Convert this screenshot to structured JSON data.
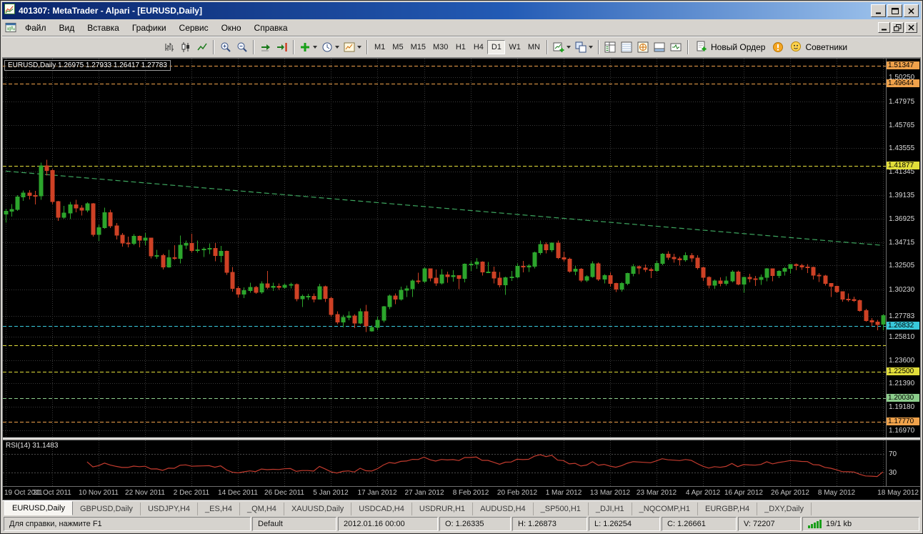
{
  "window": {
    "title": "401307: MetaTrader - Alpari - [EURUSD,Daily]"
  },
  "menu": {
    "items": [
      "Файл",
      "Вид",
      "Вставка",
      "Графики",
      "Сервис",
      "Окно",
      "Справка"
    ]
  },
  "toolbar": {
    "groups": [
      [
        "bar-chart-icon",
        "candlestick-icon",
        "line-chart-icon"
      ],
      [
        "zoom-in-icon",
        "zoom-out-icon"
      ],
      [
        "auto-scroll-icon",
        "chart-shift-icon"
      ],
      [
        {
          "icon": "indicators-icon",
          "dropdown": true
        },
        {
          "icon": "periods-icon",
          "dropdown": true
        },
        {
          "icon": "templates-icon",
          "dropdown": true
        }
      ],
      "TIMEFRAMES",
      [
        {
          "icon": "new-chart-icon",
          "dropdown": true
        },
        {
          "icon": "profiles-icon",
          "dropdown": true
        }
      ],
      [
        "market-watch-icon",
        "data-window-icon",
        "navigator-icon",
        "terminal-icon",
        "strategy-tester-icon"
      ],
      "ACTIONS"
    ],
    "timeframes": {
      "labels": [
        "M1",
        "M5",
        "M15",
        "M30",
        "H1",
        "H4",
        "D1",
        "W1",
        "MN"
      ],
      "active": "D1"
    },
    "new_order": {
      "label": "Новый Ордер",
      "icon": "new-order-icon"
    },
    "warning_icon": "warning-icon",
    "advisors": {
      "label": "Советники",
      "icon": "advisors-icon"
    }
  },
  "chart_data": {
    "type": "candlestick",
    "symbol": "EURUSD",
    "timeframe": "Daily",
    "title_ohlc": {
      "open": "1.26975",
      "high": "1.27933",
      "low": "1.26417",
      "close": "1.27783"
    },
    "y_range": [
      1.163,
      1.52
    ],
    "y_ticks": [
      "1.50250",
      "1.47975",
      "1.45765",
      "1.43555",
      "1.41345",
      "1.39135",
      "1.36925",
      "1.34715",
      "1.32505",
      "1.30230",
      "1.27783",
      "1.25810",
      "1.23600",
      "1.21390",
      "1.19180",
      "1.16970"
    ],
    "level_lines": [
      {
        "value": 1.51347,
        "label": "1.51347",
        "color": "#F0A24B"
      },
      {
        "value": 1.49644,
        "label": "1.49644",
        "color": "#F0A24B"
      },
      {
        "value": 1.41877,
        "label": "1.41877",
        "color": "#E2DE3A"
      },
      {
        "value": 1.26832,
        "label": "1.26832",
        "color": "#38C9DB"
      },
      {
        "value": 1.25,
        "label": "",
        "color": "#E2DE3A"
      },
      {
        "value": 1.225,
        "label": "1.22500",
        "color": "#E2DE3A"
      },
      {
        "value": 1.2003,
        "label": "1.20030",
        "color": "#8CCE8C"
      },
      {
        "value": 1.1777,
        "label": "1.17770",
        "color": "#F0A24B"
      }
    ],
    "trendline": {
      "from_index": 0,
      "from_value": 1.414,
      "to_index": 151,
      "to_value": 1.344,
      "color": "#3DA65F"
    },
    "colors": {
      "up": "#2CA52C",
      "down": "#CE4125",
      "background": "#000000",
      "grid": "#3A3A3A",
      "text": "#D8D8D8"
    },
    "candles": [
      [
        1.3735,
        1.3786,
        1.3655,
        1.3761
      ],
      [
        1.3761,
        1.383,
        1.371,
        1.3779
      ],
      [
        1.3779,
        1.3912,
        1.3765,
        1.3898
      ],
      [
        1.3898,
        1.3958,
        1.386,
        1.3935
      ],
      [
        1.3935,
        1.396,
        1.3873,
        1.391
      ],
      [
        1.391,
        1.3954,
        1.3826,
        1.3905
      ],
      [
        1.3905,
        1.422,
        1.387,
        1.4188
      ],
      [
        1.4188,
        1.4247,
        1.41,
        1.4147
      ],
      [
        1.4147,
        1.416,
        1.383,
        1.3852
      ],
      [
        1.3852,
        1.386,
        1.3671,
        1.3704
      ],
      [
        1.3704,
        1.3812,
        1.369,
        1.3745
      ],
      [
        1.3745,
        1.385,
        1.3687,
        1.3823
      ],
      [
        1.3823,
        1.3869,
        1.3753,
        1.3791
      ],
      [
        1.3791,
        1.3819,
        1.3723,
        1.3773
      ],
      [
        1.3773,
        1.3847,
        1.3751,
        1.3834
      ],
      [
        1.3834,
        1.3841,
        1.3523,
        1.3542
      ],
      [
        1.3542,
        1.3633,
        1.3483,
        1.3607
      ],
      [
        1.3607,
        1.3795,
        1.3597,
        1.375
      ],
      [
        1.375,
        1.3776,
        1.3603,
        1.3623
      ],
      [
        1.3623,
        1.365,
        1.3497,
        1.3535
      ],
      [
        1.3535,
        1.3556,
        1.3429,
        1.3462
      ],
      [
        1.3462,
        1.3524,
        1.3421,
        1.346
      ],
      [
        1.346,
        1.3545,
        1.3443,
        1.3525
      ],
      [
        1.3525,
        1.3532,
        1.3422,
        1.349
      ],
      [
        1.349,
        1.3555,
        1.3443,
        1.3508
      ],
      [
        1.3508,
        1.351,
        1.3317,
        1.334
      ],
      [
        1.334,
        1.3398,
        1.3315,
        1.3343
      ],
      [
        1.3343,
        1.3362,
        1.3212,
        1.3238
      ],
      [
        1.3238,
        1.3398,
        1.323,
        1.3325
      ],
      [
        1.3325,
        1.3443,
        1.3305,
        1.3318
      ],
      [
        1.3318,
        1.3533,
        1.327,
        1.3442
      ],
      [
        1.3442,
        1.3487,
        1.3406,
        1.346
      ],
      [
        1.346,
        1.355,
        1.337,
        1.339
      ],
      [
        1.339,
        1.3487,
        1.337,
        1.3398
      ],
      [
        1.3398,
        1.3421,
        1.3332,
        1.3404
      ],
      [
        1.3404,
        1.3458,
        1.3357,
        1.341
      ],
      [
        1.341,
        1.3462,
        1.329,
        1.3343
      ],
      [
        1.3343,
        1.3434,
        1.328,
        1.3386
      ],
      [
        1.3386,
        1.339,
        1.3163,
        1.3186
      ],
      [
        1.3186,
        1.3235,
        1.3005,
        1.3035
      ],
      [
        1.3035,
        1.3055,
        1.2946,
        1.2982
      ],
      [
        1.2982,
        1.3045,
        1.2945,
        1.3015
      ],
      [
        1.3015,
        1.3087,
        1.2995,
        1.3044
      ],
      [
        1.3044,
        1.3057,
        1.2983,
        1.2999
      ],
      [
        1.2999,
        1.3103,
        1.2985,
        1.3078
      ],
      [
        1.3078,
        1.3198,
        1.3028,
        1.3043
      ],
      [
        1.3043,
        1.3089,
        1.301,
        1.3054
      ],
      [
        1.3054,
        1.3083,
        1.3021,
        1.3045
      ],
      [
        1.3045,
        1.308,
        1.303,
        1.3066
      ],
      [
        1.3066,
        1.3089,
        1.3033,
        1.3071
      ],
      [
        1.3071,
        1.308,
        1.2912,
        1.2938
      ],
      [
        1.2938,
        1.2978,
        1.2858,
        1.2961
      ],
      [
        1.2961,
        1.2985,
        1.2925,
        1.2961
      ],
      [
        1.2961,
        1.2988,
        1.2903,
        1.2935
      ],
      [
        1.2935,
        1.3077,
        1.293,
        1.3052
      ],
      [
        1.3052,
        1.3062,
        1.2905,
        1.2941
      ],
      [
        1.2941,
        1.2957,
        1.2765,
        1.2788
      ],
      [
        1.2788,
        1.2818,
        1.2698,
        1.2717
      ],
      [
        1.2717,
        1.2786,
        1.2666,
        1.2761
      ],
      [
        1.2761,
        1.2818,
        1.2736,
        1.2776
      ],
      [
        1.2776,
        1.2791,
        1.2661,
        1.2709
      ],
      [
        1.2709,
        1.2845,
        1.2698,
        1.2817
      ],
      [
        1.2817,
        1.2879,
        1.2623,
        1.268
      ],
      [
        1.26335,
        1.26873,
        1.26254,
        1.26661
      ],
      [
        1.2666,
        1.277,
        1.2642,
        1.2736
      ],
      [
        1.2736,
        1.2869,
        1.2714,
        1.2862
      ],
      [
        1.2862,
        1.2977,
        1.2838,
        1.2965
      ],
      [
        1.2965,
        1.2986,
        1.2887,
        1.2932
      ],
      [
        1.2932,
        1.3052,
        1.292,
        1.3017
      ],
      [
        1.3017,
        1.3063,
        1.2953,
        1.3032
      ],
      [
        1.3032,
        1.312,
        1.2954,
        1.3106
      ],
      [
        1.3106,
        1.3184,
        1.3077,
        1.3103
      ],
      [
        1.3103,
        1.3233,
        1.3085,
        1.3218
      ],
      [
        1.3218,
        1.322,
        1.3103,
        1.3132
      ],
      [
        1.3132,
        1.3213,
        1.3057,
        1.3084
      ],
      [
        1.3084,
        1.3216,
        1.3073,
        1.3161
      ],
      [
        1.3161,
        1.3194,
        1.3087,
        1.3144
      ],
      [
        1.3144,
        1.3207,
        1.3098,
        1.3157
      ],
      [
        1.3157,
        1.316,
        1.3027,
        1.3128
      ],
      [
        1.3128,
        1.327,
        1.309,
        1.3262
      ],
      [
        1.3262,
        1.3289,
        1.32,
        1.3263
      ],
      [
        1.3263,
        1.3322,
        1.3219,
        1.3285
      ],
      [
        1.3285,
        1.3292,
        1.3157,
        1.319
      ],
      [
        1.319,
        1.3284,
        1.318,
        1.319
      ],
      [
        1.319,
        1.3241,
        1.3082,
        1.3133
      ],
      [
        1.3133,
        1.3191,
        1.3043,
        1.3067
      ],
      [
        1.3067,
        1.3146,
        1.2974,
        1.3137
      ],
      [
        1.3137,
        1.3199,
        1.3104,
        1.3143
      ],
      [
        1.3143,
        1.327,
        1.313,
        1.3243
      ],
      [
        1.3243,
        1.3293,
        1.3186,
        1.3235
      ],
      [
        1.3235,
        1.3265,
        1.3189,
        1.3245
      ],
      [
        1.3245,
        1.338,
        1.3222,
        1.337
      ],
      [
        1.337,
        1.3486,
        1.3352,
        1.3447
      ],
      [
        1.3447,
        1.3468,
        1.3365,
        1.3399
      ],
      [
        1.3399,
        1.347,
        1.3378,
        1.3461
      ],
      [
        1.3461,
        1.3487,
        1.3311,
        1.3325
      ],
      [
        1.3325,
        1.338,
        1.3288,
        1.331
      ],
      [
        1.331,
        1.3324,
        1.3184,
        1.3197
      ],
      [
        1.3197,
        1.3247,
        1.3159,
        1.3217
      ],
      [
        1.3217,
        1.3225,
        1.3096,
        1.3112
      ],
      [
        1.3112,
        1.316,
        1.3095,
        1.3146
      ],
      [
        1.3146,
        1.3289,
        1.3135,
        1.3268
      ],
      [
        1.3268,
        1.3281,
        1.3105,
        1.3123
      ],
      [
        1.3123,
        1.317,
        1.308,
        1.3157
      ],
      [
        1.3157,
        1.3186,
        1.3052,
        1.3082
      ],
      [
        1.3082,
        1.3089,
        1.3002,
        1.3027
      ],
      [
        1.3027,
        1.3095,
        1.3003,
        1.3083
      ],
      [
        1.3083,
        1.3184,
        1.3064,
        1.3175
      ],
      [
        1.3175,
        1.3265,
        1.3148,
        1.324
      ],
      [
        1.324,
        1.325,
        1.317,
        1.3228
      ],
      [
        1.3228,
        1.326,
        1.319,
        1.3214
      ],
      [
        1.3214,
        1.323,
        1.3133,
        1.3202
      ],
      [
        1.3202,
        1.3294,
        1.319,
        1.327
      ],
      [
        1.327,
        1.3368,
        1.3252,
        1.3358
      ],
      [
        1.3358,
        1.3384,
        1.3303,
        1.3327
      ],
      [
        1.3327,
        1.336,
        1.3276,
        1.3315
      ],
      [
        1.3315,
        1.3334,
        1.3251,
        1.3303
      ],
      [
        1.3303,
        1.3375,
        1.3287,
        1.3343
      ],
      [
        1.3343,
        1.3367,
        1.3283,
        1.332
      ],
      [
        1.332,
        1.3348,
        1.3213,
        1.3231
      ],
      [
        1.3231,
        1.324,
        1.3106,
        1.3139
      ],
      [
        1.3139,
        1.3149,
        1.3035,
        1.3066
      ],
      [
        1.3066,
        1.3119,
        1.3031,
        1.3105
      ],
      [
        1.3105,
        1.314,
        1.3055,
        1.308
      ],
      [
        1.308,
        1.3148,
        1.3063,
        1.3105
      ],
      [
        1.3105,
        1.3207,
        1.309,
        1.3189
      ],
      [
        1.3189,
        1.3203,
        1.3064,
        1.3076
      ],
      [
        1.3076,
        1.3147,
        1.2995,
        1.314
      ],
      [
        1.314,
        1.3173,
        1.309,
        1.3126
      ],
      [
        1.3126,
        1.3153,
        1.3058,
        1.3119
      ],
      [
        1.3119,
        1.3165,
        1.3069,
        1.3138
      ],
      [
        1.3138,
        1.3227,
        1.3102,
        1.3219
      ],
      [
        1.3219,
        1.3224,
        1.3103,
        1.3155
      ],
      [
        1.3155,
        1.3205,
        1.3133,
        1.3197
      ],
      [
        1.3197,
        1.3238,
        1.3155,
        1.3224
      ],
      [
        1.3224,
        1.3262,
        1.3176,
        1.3259
      ],
      [
        1.3259,
        1.3269,
        1.3205,
        1.3251
      ],
      [
        1.3251,
        1.3266,
        1.321,
        1.3237
      ],
      [
        1.3237,
        1.3265,
        1.318,
        1.3234
      ],
      [
        1.3234,
        1.324,
        1.3118,
        1.3159
      ],
      [
        1.3159,
        1.318,
        1.3096,
        1.3151
      ],
      [
        1.3151,
        1.3162,
        1.306,
        1.3083
      ],
      [
        1.3083,
        1.3085,
        1.2954,
        1.3055
      ],
      [
        1.3055,
        1.3062,
        1.2989,
        1.3005
      ],
      [
        1.3005,
        1.3009,
        1.2911,
        1.2933
      ],
      [
        1.2933,
        1.2988,
        1.2909,
        1.293
      ],
      [
        1.293,
        1.2958,
        1.2905,
        1.292
      ],
      [
        1.292,
        1.2929,
        1.2814,
        1.2825
      ],
      [
        1.2825,
        1.2843,
        1.2721,
        1.2732
      ],
      [
        1.2732,
        1.2754,
        1.2681,
        1.2718
      ],
      [
        1.2718,
        1.2737,
        1.2642,
        1.2696
      ],
      [
        1.26975,
        1.27933,
        1.26417,
        1.27783
      ]
    ],
    "x_labels": [
      {
        "t": "19 Oct 2011",
        "i": 0
      },
      {
        "t": "31 Oct 2011",
        "i": 8
      },
      {
        "t": "10 Nov 2011",
        "i": 16
      },
      {
        "t": "22 Nov 2011",
        "i": 24
      },
      {
        "t": "2 Dec 2011",
        "i": 32
      },
      {
        "t": "14 Dec 2011",
        "i": 40
      },
      {
        "t": "26 Dec 2011",
        "i": 48
      },
      {
        "t": "5 Jan 2012",
        "i": 56
      },
      {
        "t": "17 Jan 2012",
        "i": 64
      },
      {
        "t": "27 Jan 2012",
        "i": 72
      },
      {
        "t": "8 Feb 2012",
        "i": 80
      },
      {
        "t": "20 Feb 2012",
        "i": 88
      },
      {
        "t": "1 Mar 2012",
        "i": 96
      },
      {
        "t": "13 Mar 2012",
        "i": 104
      },
      {
        "t": "23 Mar 2012",
        "i": 112
      },
      {
        "t": "4 Apr 2012",
        "i": 120
      },
      {
        "t": "16 Apr 2012",
        "i": 127
      },
      {
        "t": "26 Apr 2012",
        "i": 135
      },
      {
        "t": "8 May 2012",
        "i": 143
      },
      {
        "t": "18 May 2012",
        "i": 151
      }
    ],
    "rsi": {
      "label": "RSI(14) 31.1483",
      "period": 14,
      "levels": [
        70,
        30
      ],
      "color": "#C23B2E",
      "range": [
        0,
        100
      ]
    }
  },
  "tabs": {
    "items": [
      "EURUSD,Daily",
      "GBPUSD,Daily",
      "USDJPY,H4",
      "_ES,H4",
      "_QM,H4",
      "XAUUSD,Daily",
      "USDCAD,H4",
      "USDRUR,H1",
      "AUDUSD,H4",
      "_SP500,H1",
      "_DJI,H1",
      "_NQCOMP,H1",
      "EURGBP,H4",
      "_DXY,Daily"
    ],
    "active_index": 0
  },
  "status": {
    "help": "Для справки, нажмите F1",
    "profile": "Default",
    "time": "2012.01.16 00:00",
    "open": "O: 1.26335",
    "high": "H: 1.26873",
    "low": "L: 1.26254",
    "close": "C: 1.26661",
    "volume": "V: 72207",
    "traffic": "19/1 kb"
  }
}
